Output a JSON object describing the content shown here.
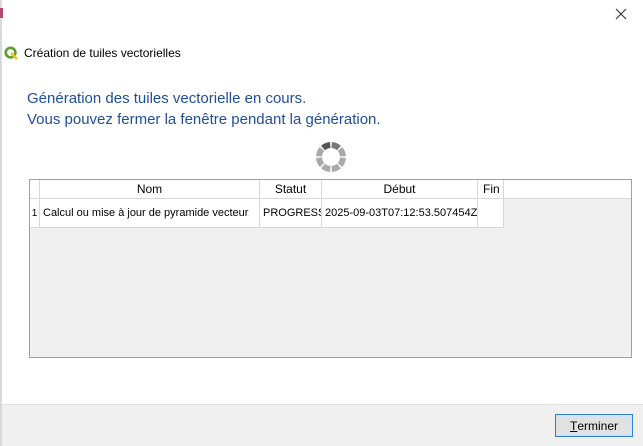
{
  "window": {
    "title": "Création de tuiles vectorielles",
    "logo_icon": "qgis-logo-icon",
    "close_icon": "close-icon",
    "accent_color": "#1f4e9c"
  },
  "message": {
    "line1": "Génération des tuiles vectorielle en cours.",
    "line2": "Vous pouvez fermer la fenêtre pendant la génération."
  },
  "spinner": {
    "icon": "loading-spinner-icon"
  },
  "table": {
    "columns": [
      "Nom",
      "Statut",
      "Début",
      "Fin"
    ],
    "rows": [
      {
        "index": "1",
        "nom": "Calcul ou mise à jour de pyramide vecteur",
        "statut": "PROGRESS",
        "debut": "2025-09-03T07:12:53.507454Z",
        "fin": ""
      }
    ]
  },
  "footer": {
    "terminer_mnemonic": "T",
    "terminer_rest": "erminer"
  }
}
